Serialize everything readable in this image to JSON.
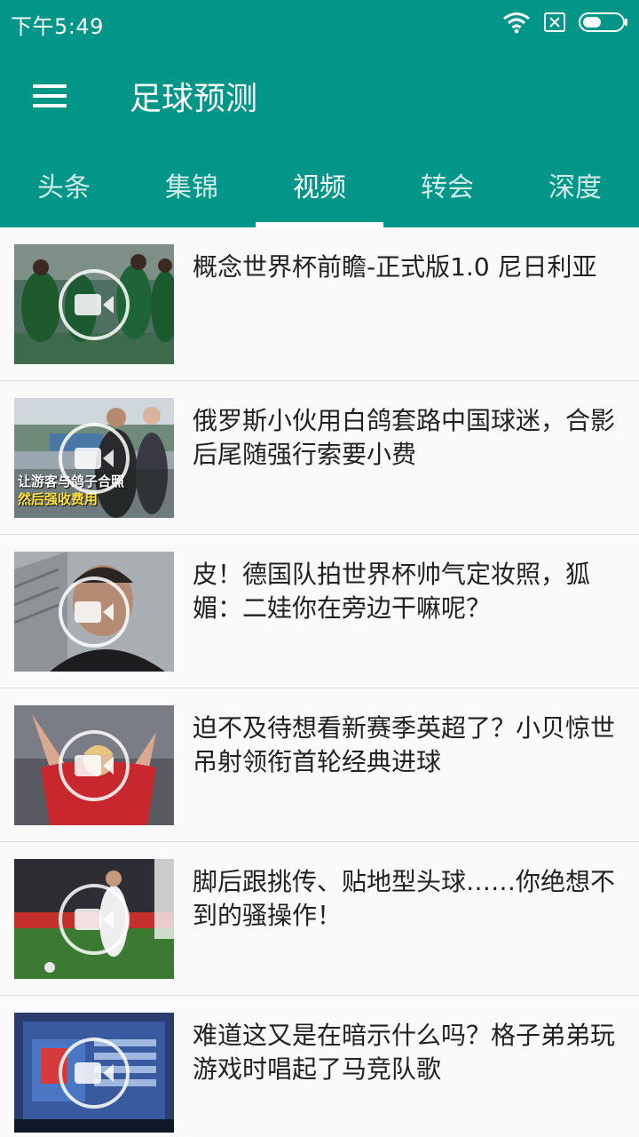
{
  "status": {
    "time": "下午5:49"
  },
  "toolbar": {
    "title": "足球预测"
  },
  "tabs": [
    {
      "label": "头条"
    },
    {
      "label": "集锦"
    },
    {
      "label": "视频"
    },
    {
      "label": "转会"
    },
    {
      "label": "深度"
    }
  ],
  "active_tab": "视频",
  "videos": [
    {
      "title": "概念世界杯前瞻-正式版1.0 尼日利亚"
    },
    {
      "title": "俄罗斯小伙用白鸽套路中国球迷，合影后尾随强行索要小费",
      "thumb_caption_1": "让游客与鸽子合照",
      "thumb_caption_2": "然后强收费用"
    },
    {
      "title": "皮！德国队拍世界杯帅气定妆照，狐媚：二娃你在旁边干嘛呢？"
    },
    {
      "title": "迫不及待想看新赛季英超了？小贝惊世吊射领衔首轮经典进球"
    },
    {
      "title": "脚后跟挑传、贴地型头球……你绝想不到的骚操作！"
    },
    {
      "title": "难道这又是在暗示什么吗？格子弟弟玩游戏时唱起了马竞队歌"
    }
  ],
  "colors": {
    "primary": "#019688",
    "text": "#212121",
    "divider": "#dedede",
    "list_bg": "#fafafa"
  },
  "icons": {
    "menu": "hamburger-icon",
    "wifi": "wifi-icon",
    "sim": "no-sim-icon",
    "battery": "battery-icon",
    "play": "video-camera-icon"
  }
}
